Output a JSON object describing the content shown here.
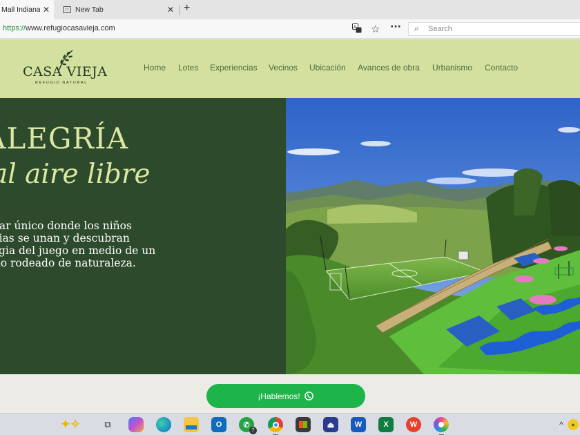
{
  "browser": {
    "tabs": [
      {
        "label": "Mall Indiana",
        "active": true
      },
      {
        "label": "New Tab",
        "active": false
      }
    ],
    "address": {
      "scheme": "https://",
      "host": "www.refugiocasavieja.com"
    },
    "search_placeholder": "Search",
    "icons": [
      "translate-icon",
      "favorite-star-icon",
      "more-menu-icon",
      "search-icon"
    ]
  },
  "site": {
    "logo": {
      "brand": "CASA VIEJA",
      "tagline": "REFUGIO NATURAL"
    },
    "nav": [
      "Home",
      "Lotes",
      "Experiencias",
      "Vecinos",
      "Ubicación",
      "Avances de obra",
      "Urbanismo",
      "Contacto"
    ],
    "hero": {
      "title_line1": "ALEGRÍA",
      "title_line2": "al aire libre",
      "description_lines": [
        "lugar único donde los niños",
        "milias se unan y descubran",
        "magia del juego en medio de un",
        "orno rodeado de naturaleza."
      ]
    },
    "cta": {
      "label": "¡Hablemos!",
      "icon": "whatsapp-icon"
    }
  },
  "taskbar": {
    "icons": [
      "copilot-sparkle-icon",
      "task-view-icon",
      "copilot-app-icon",
      "edge-browser-icon",
      "file-explorer-icon",
      "outlook-icon",
      "whatsapp-icon",
      "chrome-icon",
      "store-icon",
      "azure-data-icon",
      "word-icon",
      "excel-icon",
      "wps-office-icon",
      "photos-icon",
      "chevron-up-icon"
    ],
    "whatsapp_badge": "7"
  },
  "colors": {
    "header_bg": "#d4e09f",
    "hero_bg": "#2e4a2c",
    "hero_text": "#dbe7a4",
    "nav_text": "#4c6b3c",
    "cta_bg": "#1db449"
  }
}
